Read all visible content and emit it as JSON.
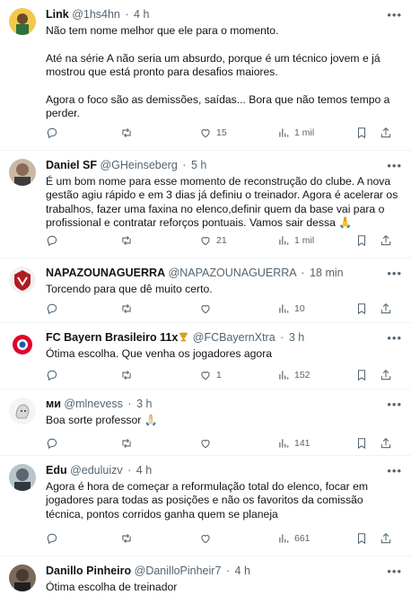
{
  "tweets": [
    {
      "name": "Link",
      "handle": "@1hs4hn",
      "time": "4 h",
      "text": "Não tem nome melhor que ele para o momento.\n\nAté na série A não seria um absurdo, porque é um técnico jovem e já mostrou que está pronto para desafios maiores.\n\nAgora o foco são as demissões, saídas... Bora que não temos tempo a perder.",
      "replies": "",
      "retweets": "",
      "likes": "15",
      "views": "1 mil",
      "avatar_color": "#f2c94c"
    },
    {
      "name": "Daniel SF",
      "handle": "@GHeinseberg",
      "time": "5 h",
      "text": "É um bom nome para esse momento de reconstrução do clube. A nova gestão agiu rápido e em 3 dias já definiu o treinador. Agora é acelerar os trabalhos, fazer uma faxina no elenco,definir quem da base vai para o profissional e contratar reforços pontuais. Vamos sair dessa 🙏",
      "replies": "",
      "retweets": "",
      "likes": "21",
      "views": "1 mil",
      "avatar_color": "#8a6a55"
    },
    {
      "name": "NAPAZOUNAGUERRA",
      "handle": "@NAPAZOUNAGUERRA",
      "time": "18 min",
      "text": "Torcendo para que dê muito certo.",
      "replies": "",
      "retweets": "",
      "likes": "",
      "views": "10",
      "avatar_color": "#b01c22"
    },
    {
      "name": "FC Bayern Brasileiro 11x",
      "handle": "@FCBayernXtra",
      "time": "3 h",
      "text": "Ótima escolha. Que venha os jogadores agora",
      "replies": "",
      "retweets": "",
      "likes": "1",
      "views": "152",
      "avatar_color": "#dc052d"
    },
    {
      "name": "ми",
      "handle": "@mlnevess",
      "time": "3 h",
      "text": "Boa sorte professor 🙏🏻",
      "replies": "",
      "retweets": "",
      "likes": "",
      "views": "141",
      "avatar_color": "#d9d9d9"
    },
    {
      "name": "Edu",
      "handle": "@eduluizv",
      "time": "4 h",
      "text": "Agora é hora de começar a reformulação total do elenco, focar em jogadores para todas as posições e não os favoritos da comissão técnica, pontos corridos ganha quem se planeja",
      "replies": "",
      "retweets": "",
      "likes": "",
      "views": "661",
      "avatar_color": "#5b6770"
    },
    {
      "name": "Danillo Pinheiro",
      "handle": "@DanilloPinheir7",
      "time": "4 h",
      "text": "Ótima escolha de treinador",
      "replies": "",
      "retweets": "",
      "likes": "",
      "views": "",
      "avatar_color": "#4a3a30"
    }
  ],
  "colors": {
    "text": "#0f1419",
    "secondary": "#536471",
    "divider": "#eff3f4",
    "trophy": "#d4a017"
  },
  "icons": [
    "reply-icon",
    "retweet-icon",
    "like-icon",
    "views-icon",
    "bookmark-icon",
    "share-icon",
    "more-icon",
    "trophy-icon"
  ]
}
